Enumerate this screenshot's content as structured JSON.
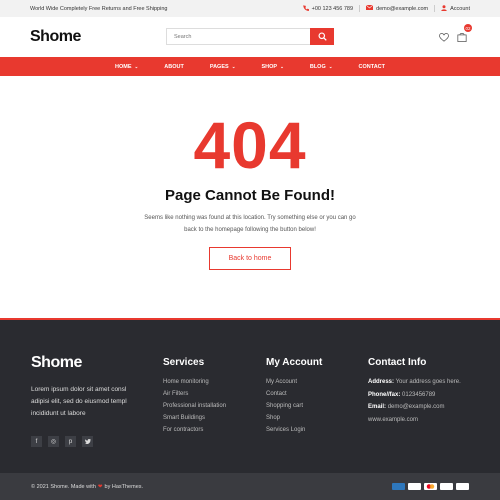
{
  "colors": {
    "accent": "#e8392f",
    "footer_bg": "#2a2b30",
    "bottom_bg": "#3a3b40"
  },
  "topbar": {
    "promo": "World Wide Completely Free Returns and Free Shipping",
    "phone": "+00 123 456 789",
    "email": "demo@example.com",
    "account": "Account"
  },
  "header": {
    "logo": "Shome",
    "search_placeholder": "Search",
    "cart_count": "02"
  },
  "nav": {
    "items": [
      {
        "label": "HOME",
        "has_dropdown": true
      },
      {
        "label": "ABOUT",
        "has_dropdown": false
      },
      {
        "label": "PAGES",
        "has_dropdown": true
      },
      {
        "label": "SHOP",
        "has_dropdown": true
      },
      {
        "label": "BLOG",
        "has_dropdown": true
      },
      {
        "label": "CONTACT",
        "has_dropdown": false
      }
    ]
  },
  "error": {
    "code": "404",
    "title": "Page Cannot Be Found!",
    "description": "Seems like nothing was found at this location. Try something else or you can go back to the homepage following the button below!",
    "button": "Back to home"
  },
  "footer": {
    "logo": "Shome",
    "about": "Lorem ipsum dolor sit amet consl adipisi elit, sed do eiusmod templ incididunt ut labore",
    "social": [
      "facebook-icon",
      "dribbble-icon",
      "pinterest-icon",
      "twitter-icon"
    ],
    "services": {
      "heading": "Services",
      "items": [
        "Home monitoring",
        "Air Filters",
        "Professional installation",
        "Smart Buildings",
        "For contractors"
      ]
    },
    "account": {
      "heading": "My Account",
      "items": [
        "My Account",
        "Contact",
        "Shopping cart",
        "Shop",
        "Services Login"
      ]
    },
    "contact": {
      "heading": "Contact Info",
      "address_label": "Address:",
      "address": "Your address goes here.",
      "phone_label": "Phone//fax:",
      "phone": "0123456789",
      "email_label": "Email:",
      "email": "demo@example.com",
      "website": "www.example.com"
    }
  },
  "bottom": {
    "copyright_prefix": "© 2021 Shome. Made with",
    "copyright_suffix": "by HasThemes.",
    "payments": [
      "AMEX",
      "PAYPAL",
      "MC",
      "DISC",
      "VISA"
    ]
  }
}
